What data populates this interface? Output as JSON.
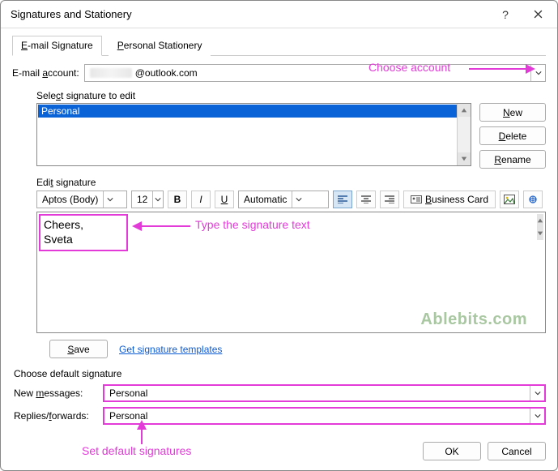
{
  "dialog": {
    "title": "Signatures and Stationery"
  },
  "tabs": {
    "email": "E-mail Signature",
    "stationery": "Personal Stationery"
  },
  "account": {
    "label": "E-mail account:",
    "value_suffix": "@outlook.com"
  },
  "select_section": {
    "label": "Select signature to edit",
    "items": [
      "Personal"
    ]
  },
  "buttons": {
    "new": "New",
    "delete": "Delete",
    "rename": "Rename",
    "save": "Save",
    "ok": "OK",
    "cancel": "Cancel"
  },
  "edit_section": {
    "label": "Edit signature",
    "font": "Aptos (Body)",
    "size": "12",
    "color": "Automatic",
    "business_card": "Business Card"
  },
  "signature": {
    "line1": "Cheers,",
    "line2": "Sveta"
  },
  "watermark": "Ablebits.com",
  "link": "Get signature templates",
  "defaults": {
    "section_label": "Choose default signature",
    "new_label": "New messages:",
    "new_value": "Personal",
    "replies_label": "Replies/forwards:",
    "replies_value": "Personal"
  },
  "annotations": {
    "choose_account": "Choose account",
    "type_sig": "Type the signature text",
    "set_defaults": "Set default signatures"
  }
}
